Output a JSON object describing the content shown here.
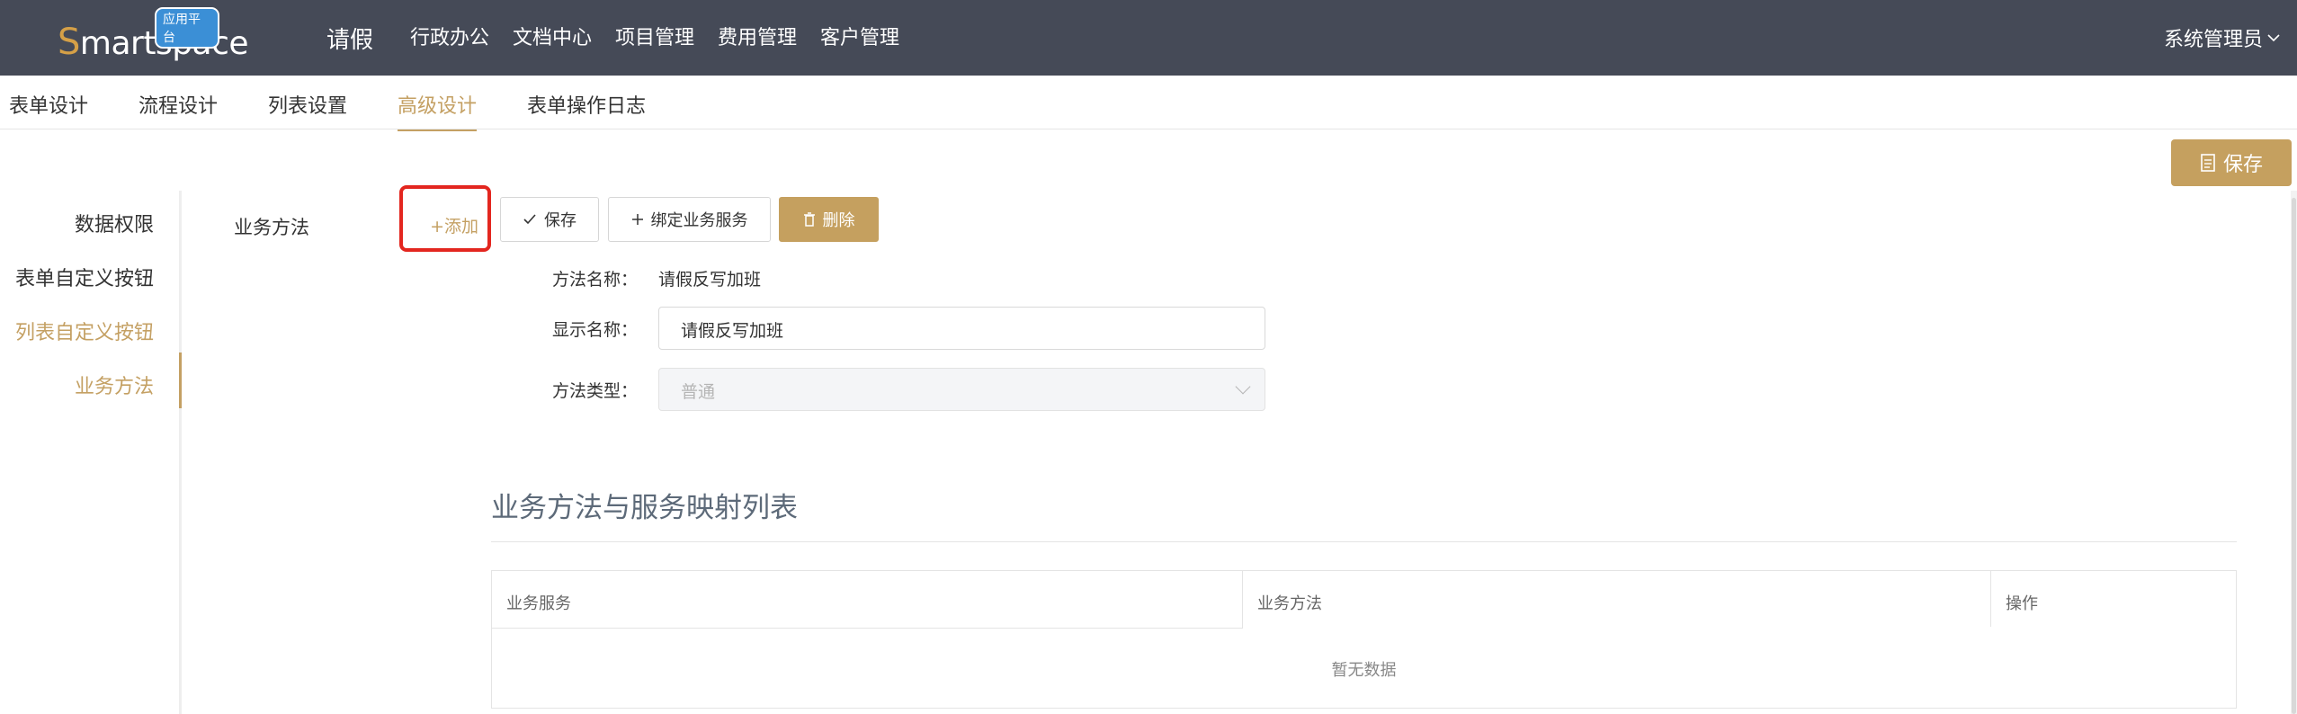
{
  "header": {
    "logo_prefix": "S",
    "logo_rest": "martspace",
    "logo_badge": "应用平台",
    "app_title": "请假",
    "nav": [
      "行政办公",
      "文档中心",
      "项目管理",
      "费用管理",
      "客户管理"
    ],
    "user": "系统管理员"
  },
  "tabs": [
    "表单设计",
    "流程设计",
    "列表设置",
    "高级设计",
    "表单操作日志"
  ],
  "active_tab": "高级设计",
  "save_top_label": "保存",
  "sidebar": {
    "items": [
      "数据权限",
      "表单自定义按钮",
      "列表自定义按钮",
      "业务方法"
    ],
    "active": "业务方法"
  },
  "section": {
    "label": "业务方法",
    "buttons": {
      "add": "+添加",
      "save": "保存",
      "bind": "绑定业务服务",
      "delete": "删除"
    },
    "form": {
      "method_name_label": "方法名称：",
      "method_name_value": "请假反写加班",
      "display_name_label": "显示名称：",
      "display_name_value": "请假反写加班",
      "method_type_label": "方法类型：",
      "method_type_value": "普通"
    }
  },
  "mapping": {
    "heading": "业务方法与服务映射列表",
    "columns": [
      "业务服务",
      "业务方法",
      "操作"
    ],
    "empty_text": "暂无数据",
    "rows": []
  },
  "colors": {
    "topbar": "#454a57",
    "accent": "#c4a063",
    "highlight_border": "#e3261f"
  }
}
